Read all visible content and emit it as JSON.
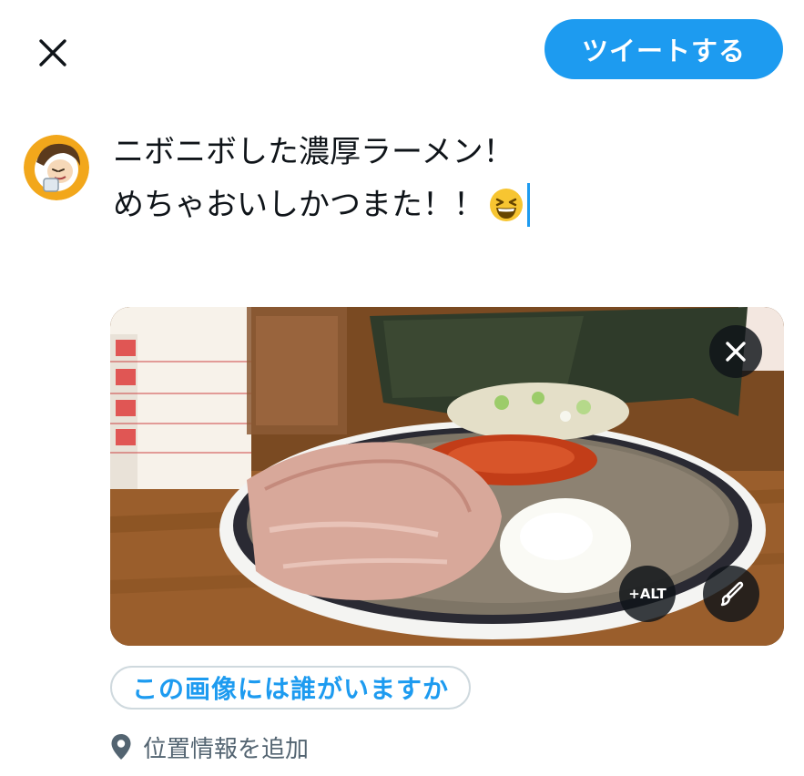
{
  "header": {
    "close_icon": "close-icon",
    "tweet_button_label": "ツイートする"
  },
  "composer": {
    "avatar_icon": "avatar",
    "lines": [
      "ニボニボした濃厚ラーメン！",
      "めちゃおいしかつまた！！"
    ],
    "emoji": "grinning-squinting-face-emoji"
  },
  "media": {
    "description_icon": "ramen-photo",
    "remove_icon": "close-icon",
    "alt_label": "+ALT",
    "edit_icon": "paintbrush-icon"
  },
  "actions": {
    "tag_people_label": "この画像には誰がいますか",
    "location_label": "位置情報を追加",
    "location_icon": "location-pin-icon"
  },
  "colors": {
    "accent": "#1d9bf0",
    "text": "#0f1419",
    "secondary_text": "#536471",
    "border": "#cfd9de"
  }
}
